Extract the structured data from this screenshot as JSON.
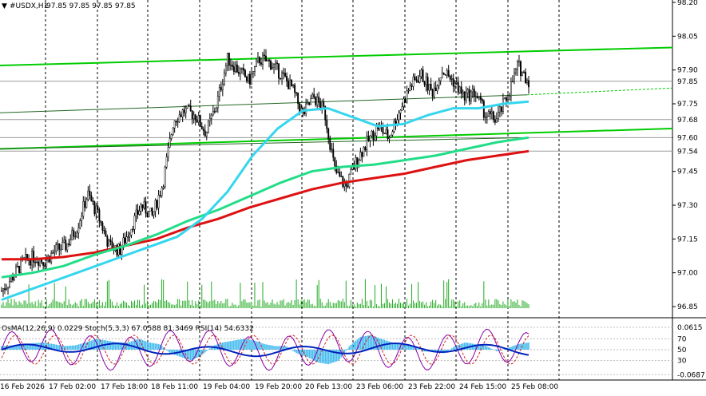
{
  "header": {
    "symbol": "#USDX,H1",
    "ohlc": "97.85 97.85 97.85 97.85"
  },
  "indicator_label": "OsMA(12,26,9) 0.0229  Stoch(5,3,3) 67.0588 81.3469  RSI(14) 54.6332",
  "colors": {
    "grid": "#000000",
    "channel": "#00cc00",
    "ma_fast": "#33d6ee",
    "ma_mid": "#22dd88",
    "ma_slow": "#dd1111",
    "candle": "#000000",
    "volume": "#22aa22",
    "osma": "#44bbee",
    "stoch": "#8800aa",
    "rsi": "#0022bb"
  },
  "chart_data": {
    "type": "candlestick",
    "instrument": "#USDX",
    "timeframe": "H1",
    "price_axis": {
      "ticks": [
        {
          "label": "98.20",
          "v": 98.2
        },
        {
          "label": "98.05",
          "v": 98.05
        },
        {
          "label": "97.90",
          "v": 97.9
        },
        {
          "label": "97.75",
          "v": 97.75
        },
        {
          "label": "97.60",
          "v": 97.6
        },
        {
          "label": "97.45",
          "v": 97.45
        },
        {
          "label": "97.30",
          "v": 97.3
        },
        {
          "label": "97.15",
          "v": 97.15
        },
        {
          "label": "97.00",
          "v": 97.0
        },
        {
          "label": "96.85",
          "v": 96.85
        }
      ],
      "marked_levels": [
        {
          "label": "97.85",
          "v": 97.85
        },
        {
          "label": "97.68",
          "v": 97.68
        },
        {
          "label": "97.60",
          "v": 97.6
        },
        {
          "label": "97.54",
          "v": 97.54
        }
      ]
    },
    "time_axis": [
      "16 Feb 2026",
      "17 Feb 02:00",
      "17 Feb 18:00",
      "18 Feb 11:00",
      "19 Feb 04:00",
      "19 Feb 20:00",
      "20 Feb 13:00",
      "23 Feb 06:00",
      "23 Feb 22:00",
      "24 Feb 15:00",
      "25 Feb 08:00"
    ],
    "close_path": [
      96.92,
      96.98,
      97.05,
      97.07,
      97.05,
      97.1,
      97.12,
      97.2,
      97.35,
      97.25,
      97.12,
      97.1,
      97.2,
      97.3,
      97.25,
      97.4,
      97.68,
      97.72,
      97.7,
      97.62,
      97.75,
      97.95,
      97.9,
      97.85,
      97.95,
      97.93,
      97.88,
      97.82,
      97.7,
      97.78,
      97.72,
      97.45,
      97.38,
      97.5,
      97.58,
      97.65,
      97.6,
      97.72,
      97.83,
      97.88,
      97.8,
      97.9,
      97.85,
      97.78,
      97.8,
      97.7,
      97.68,
      97.78,
      97.92,
      97.85
    ],
    "ma_fast": [
      96.88,
      96.92,
      96.96,
      97.0,
      97.04,
      97.08,
      97.12,
      97.16,
      97.24,
      97.36,
      97.52,
      97.64,
      97.72,
      97.73,
      97.69,
      97.65,
      97.66,
      97.7,
      97.73,
      97.73,
      97.75,
      97.76
    ],
    "ma_mid": [
      96.98,
      97.0,
      97.03,
      97.08,
      97.12,
      97.17,
      97.23,
      97.28,
      97.34,
      97.4,
      97.45,
      97.47,
      97.48,
      97.5,
      97.52,
      97.55,
      97.58,
      97.6
    ],
    "ma_slow": [
      97.06,
      97.06,
      97.07,
      97.09,
      97.12,
      97.15,
      97.2,
      97.24,
      97.29,
      97.33,
      97.37,
      97.4,
      97.42,
      97.44,
      97.47,
      97.5,
      97.52,
      97.54
    ],
    "oscillator_axis": [
      {
        "label": "0.0615",
        "v": 0.0615
      },
      {
        "label": "70",
        "v": 0.03
      },
      {
        "label": "50",
        "v": 0.0
      },
      {
        "label": "30",
        "v": -0.03
      },
      {
        "label": "-0.0687",
        "v": -0.0687
      }
    ],
    "osma_values": [
      0.01,
      0.012,
      0.015,
      0.018,
      0.02,
      0.015,
      0.01,
      0.012,
      0.02,
      0.03,
      0.025,
      0.02,
      0.02,
      0.03,
      0.02,
      0.015,
      -0.01,
      -0.02,
      -0.03,
      -0.015,
      0.01,
      0.02,
      0.025,
      0.03,
      0.025,
      0.015,
      0.01,
      0.01,
      -0.01,
      -0.02,
      -0.035,
      -0.04,
      -0.03,
      0.01,
      0.035,
      0.04,
      0.03,
      0.02,
      0.015,
      0.01,
      -0.005,
      -0.005,
      -0.01,
      0.01,
      0.02,
      0.015,
      0.01,
      -0.005,
      0.005,
      0.015,
      0.02
    ]
  }
}
